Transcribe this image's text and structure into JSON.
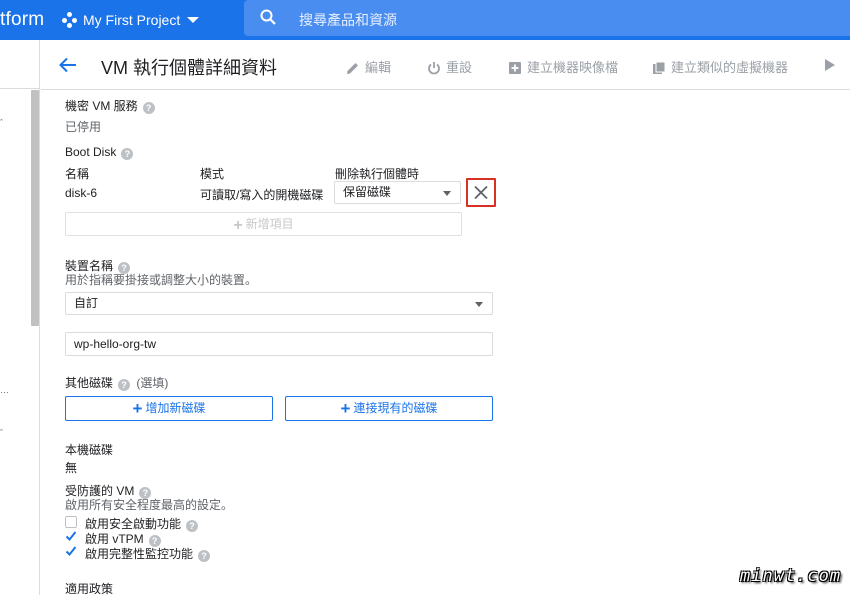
{
  "topbar": {
    "brand": "tform",
    "project_name": "My First Project",
    "search_placeholder": "搜尋產品和資源",
    "colors": {
      "bar": "#1a73e8",
      "search": "#4a8df0"
    }
  },
  "header": {
    "title": "VM 執行個體詳細資料",
    "actions": [
      {
        "label": "編輯",
        "icon": "pencil-icon"
      },
      {
        "label": "重設",
        "icon": "power-icon"
      },
      {
        "label": "建立機器映像檔",
        "icon": "add-box-icon"
      },
      {
        "label": "建立類似的虛擬機器",
        "icon": "copy-icon"
      }
    ]
  },
  "confidential_vm": {
    "label": "機密 VM 服務",
    "value": "已停用"
  },
  "boot_disk": {
    "label": "Boot Disk",
    "columns": [
      "名稱",
      "模式",
      "刪除執行個體時"
    ],
    "row": {
      "name": "disk-6",
      "mode": "可讀取/寫入的開機磁碟",
      "on_delete": "保留磁碟"
    },
    "add_item_label": "新增項目"
  },
  "device_name": {
    "label": "裝置名稱",
    "description": "用於指稱要掛接或調整大小的裝置。",
    "select_value": "自訂",
    "input_value": "wp-hello-org-tw"
  },
  "other_disks": {
    "label": "其他磁碟",
    "optional": "(選填)",
    "add_new_label": "增加新磁碟",
    "attach_existing_label": "連接現有的磁碟"
  },
  "local_disk": {
    "label": "本機磁碟",
    "value": "無"
  },
  "shielded_vm": {
    "label": "受防護的 VM",
    "description": "啟用所有安全程度最高的設定。",
    "options": [
      {
        "label": "啟用安全啟動功能",
        "checked": false
      },
      {
        "label": "啟用 vTPM",
        "checked": true
      },
      {
        "label": "啟用完整性監控功能",
        "checked": true
      }
    ]
  },
  "policy": {
    "label": "適用政策"
  },
  "watermark": "minwt.com"
}
